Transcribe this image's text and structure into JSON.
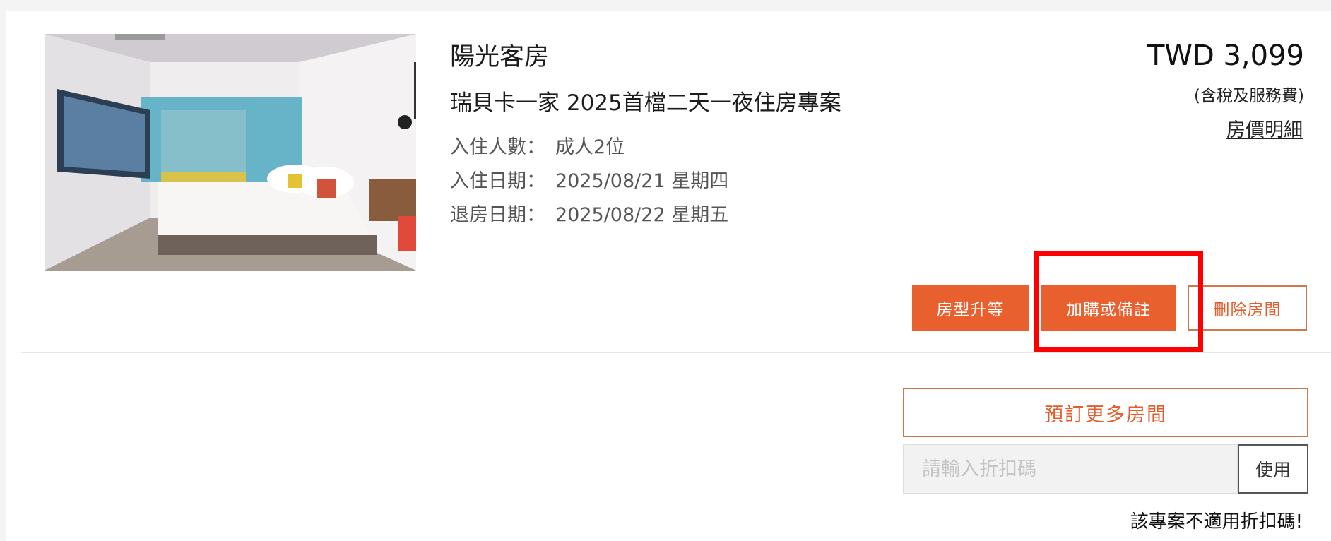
{
  "room": {
    "name": "陽光客房",
    "plan": "瑞貝卡一家 2025首檔二天一夜住房專案",
    "guests_label": "入住人數：",
    "guests_value": "成人2位",
    "checkin_label": "入住日期：",
    "checkin_value": "2025/08/21 星期四",
    "checkout_label": "退房日期：",
    "checkout_value": "2025/08/22 星期五"
  },
  "pricing": {
    "price": "TWD 3,099",
    "tax_note": "(含稅及服務費)",
    "detail_link": "房價明細"
  },
  "actions": {
    "upgrade": "房型升等",
    "addon": "加購或備註",
    "delete": "刪除房間"
  },
  "booking": {
    "book_more": "預訂更多房間",
    "coupon_placeholder": "請輸入折扣碼",
    "coupon_apply": "使用",
    "coupon_note": "該專案不適用折扣碼!"
  },
  "colors": {
    "accent": "#e9602f",
    "highlight": "#ff0000"
  }
}
